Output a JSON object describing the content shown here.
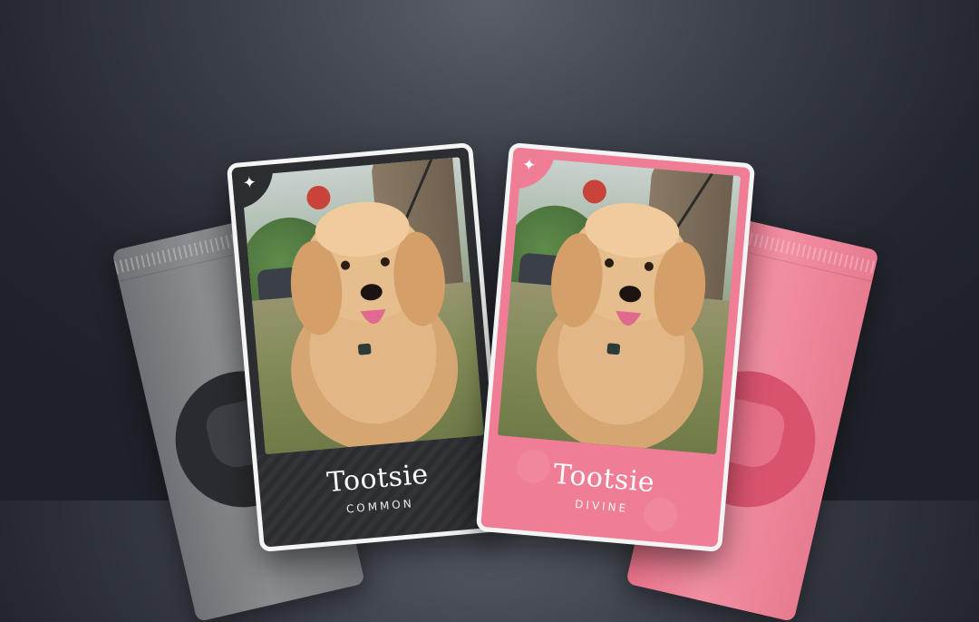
{
  "cards": [
    {
      "name": "Tootsie",
      "rarity": "COMMON",
      "theme": "dark",
      "border_color": "#f4f4f4",
      "badge_icon": "sparkle-icon"
    },
    {
      "name": "Tootsie",
      "rarity": "DIVINE",
      "theme": "pink",
      "border_color": "#f4f4f4",
      "badge_icon": "sparkle-icon"
    }
  ],
  "packs": [
    {
      "theme": "dark",
      "color": "#7f8186",
      "emblem_icon": "pet-logo-icon"
    },
    {
      "theme": "pink",
      "color": "#ee8399",
      "emblem_icon": "pet-logo-icon"
    }
  ],
  "badge_glyph": "✦",
  "colors": {
    "background": "#2a2d35",
    "dark_card": "#2c2d31",
    "pink_card": "#ef7d95"
  }
}
